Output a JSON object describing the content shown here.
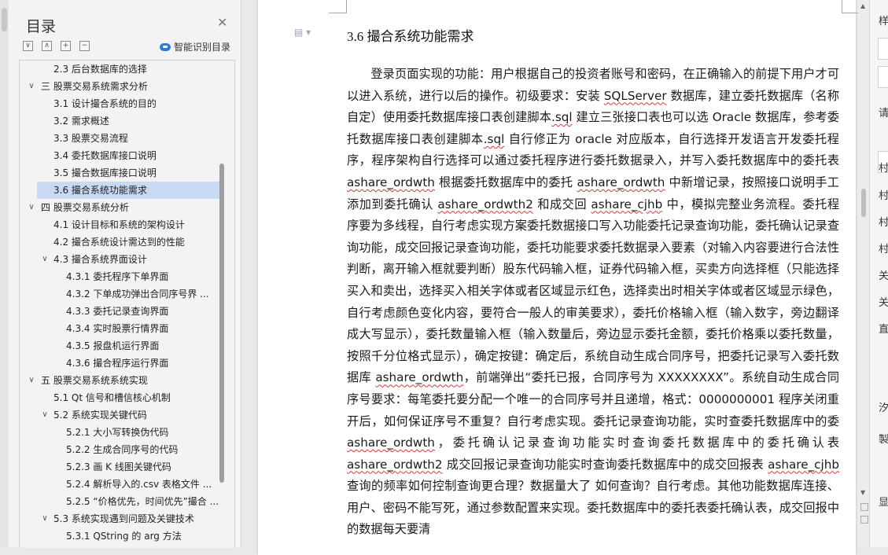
{
  "toc": {
    "title": "目录",
    "close_icon": "close-icon",
    "smart_toc_label": "智能识别目录",
    "items": [
      {
        "label": "2.3  后台数据库的选择",
        "level": 2,
        "chev": ""
      },
      {
        "label": "三  股票交易系统需求分析",
        "level": 1,
        "chev": "∨"
      },
      {
        "label": "3.1  设计撮合系统的目的",
        "level": 2,
        "chev": ""
      },
      {
        "label": "3.2  需求概述",
        "level": 2,
        "chev": ""
      },
      {
        "label": "3.3  股票交易流程",
        "level": 2,
        "chev": ""
      },
      {
        "label": "3.4  委托数据库接口说明",
        "level": 2,
        "chev": ""
      },
      {
        "label": "3.5  撮合数据库接口说明",
        "level": 2,
        "chev": ""
      },
      {
        "label": "3.6  撮合系统功能需求",
        "level": 2,
        "chev": "",
        "active": true
      },
      {
        "label": "四  股票交易系统分析",
        "level": 1,
        "chev": "∨"
      },
      {
        "label": "4.1  设计目标和系统的架构设计",
        "level": 2,
        "chev": ""
      },
      {
        "label": "4.2  撮合系统设计需达到的性能",
        "level": 2,
        "chev": ""
      },
      {
        "label": "4.3  撮合系统界面设计",
        "level": 2,
        "chev": "∨"
      },
      {
        "label": "4.3.1  委托程序下单界面",
        "level": 3,
        "chev": ""
      },
      {
        "label": "4.3.2  下单成功弹出合同序号界 ...",
        "level": 3,
        "chev": ""
      },
      {
        "label": "4.3.3  委托记录查询界面",
        "level": 3,
        "chev": ""
      },
      {
        "label": "4.3.4  实时股票行情界面",
        "level": 3,
        "chev": ""
      },
      {
        "label": "4.3.5  报盘机运行界面",
        "level": 3,
        "chev": ""
      },
      {
        "label": "4.3.6  撮合程序运行界面",
        "level": 3,
        "chev": ""
      },
      {
        "label": "五  股票交易系统系统实现",
        "level": 1,
        "chev": "∨"
      },
      {
        "label": "5.1 Qt 信号和槽信核心机制",
        "level": 2,
        "chev": ""
      },
      {
        "label": "5.2  系统实现关键代码",
        "level": 2,
        "chev": "∨"
      },
      {
        "label": "5.2.1  大小写转换伪代码",
        "level": 3,
        "chev": ""
      },
      {
        "label": "5.2.2  生成合同序号的代码",
        "level": 3,
        "chev": ""
      },
      {
        "label": "5.2.3  画 K 线图关键代码",
        "level": 3,
        "chev": ""
      },
      {
        "label": "5.2.4  解析导入的.csv 表格文件 ...",
        "level": 3,
        "chev": ""
      },
      {
        "label": "5.2.5  “价格优先，时间优先”撮合 ...",
        "level": 3,
        "chev": ""
      },
      {
        "label": "5.3  系统实现遇到问题及关键技术",
        "level": 2,
        "chev": "∨"
      },
      {
        "label": "5.3.1    QString 的 arg 方法",
        "level": 3,
        "chev": ""
      }
    ]
  },
  "document": {
    "heading": "3.6  撮合系统功能需求",
    "paragraph": [
      {
        "t": "登录页面实现的功能：用户根据自己的投资者账号和密码，在正确输入的前提下用户才可以进入系统，进行以后的操作。初级要求：安装 "
      },
      {
        "t": "SQLServer",
        "u": true
      },
      {
        "t": " 数据库，建立委托数据库（名称自定）使用委托数据库接口表创建脚本"
      },
      {
        "t": ".sql",
        "u": true
      },
      {
        "t": " 建立三张接口表也可以选 Oracle 数据库，参考委托数据库接口表创建脚本"
      },
      {
        "t": ".sql",
        "u": true
      },
      {
        "t": " 自行修正为 oracle 对应版本，自行选择开发语言开发委托程序，程序架构自行选择可以通过委托程序进行委托数据录入，并写入委托数据库中的委托表 "
      },
      {
        "t": "ashare_ordwth",
        "u": true
      },
      {
        "t": " 根据委托数据库中的委托 "
      },
      {
        "t": "ashare_ordwth",
        "u": true
      },
      {
        "t": " 中新增记录，按照接口说明手工添加到委托确认 "
      },
      {
        "t": "ashare_ordwth2",
        "u": true
      },
      {
        "t": " 和成交回 "
      },
      {
        "t": "ashare_cjhb",
        "u": true
      },
      {
        "t": " 中，模拟完整业务流程。委托程序要为多线程，自行考虑实现方案委托数据接口写入功能委托记录查询功能，委托确认记录查询功能，成交回报记录查询功能，委托功能要求委托数据录入要素（对输入内容要进行合法性判断，离开输入框就要判断）股东代码输入框，证券代码输入框，买卖方向选择框（只能选择买入和卖出，选择买入相关字体或者区域显示红色，选择卖出时相关字体或者区域显示绿色，自行考虑颜色变化内容，要符合一般人的审美要求），委托价格输入框（输入数字，旁边翻译成大写显示），委托数量输入框（输入数量后，旁边显示委托金额，委托价格乘以委托数量，按照千分位格式显示），确定按键：确定后，系统自动生成合同序号，把委托记录写入委托数据库 "
      },
      {
        "t": "ashare_ordwth",
        "u": true
      },
      {
        "t": "，前端弹出“委托已报，合同序号为 XXXXXXXX”。系统自动生成合同序号要求：每笔委托要分配一个唯一的合同序号并且递增，格式：0000000001 程序关闭重开后，如何保证序号不重复？自行考虑实现。委托记录查询功能，实时查委托数据库中的委 "
      },
      {
        "t": "ashare_ordwth",
        "u": true
      },
      {
        "t": "，委托确认记录查询功能实时查询委托数据库中的委托确认表 "
      },
      {
        "t": "ashare_ordwth2",
        "u": true
      },
      {
        "t": " 成交回报记录查询功能实时查询委托数据库中的成交回报表 "
      },
      {
        "t": "ashare_cjhb",
        "u": true
      },
      {
        "t": " 查询的频率如何控制查询更合理？数据量大了  如何查询？自行考虑。其他功能数据库连接、用户、密码不能写死，通过参数配置来实现。委托数据库中的委托表委托确认表，成交回报中的数据每天要清"
      }
    ]
  },
  "style_pane": {
    "labels": [
      "样",
      "请",
      "村",
      "村",
      "村",
      "村",
      "关",
      "关",
      "直",
      "汐",
      "製",
      "显"
    ]
  }
}
